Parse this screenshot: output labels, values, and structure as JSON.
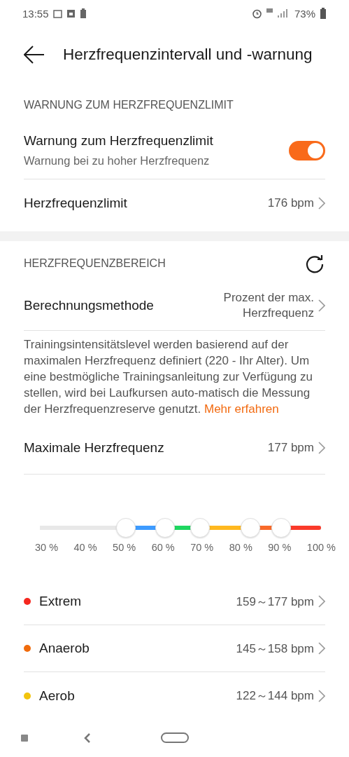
{
  "status_bar": {
    "time": "13:55",
    "battery": "73%"
  },
  "header": {
    "title": "Herzfrequenzintervall und -warnung"
  },
  "limit_section": {
    "title": "WARNUNG ZUM HERZFREQUENZLIMIT",
    "warning": {
      "label": "Warnung zum Herzfrequenzlimit",
      "sublabel": "Warnung bei zu hoher Herzfrequenz",
      "on": true
    },
    "limit": {
      "label": "Herzfrequenzlimit",
      "value": "176 bpm"
    }
  },
  "range_section": {
    "title": "HERZFREQUENZBEREICH",
    "method": {
      "label": "Berechnungsmethode",
      "value": "Prozent der max. Herzfrequenz"
    },
    "description": "Trainingsintensitätslevel werden basierend auf der maximalen Herzfrequenz definiert (220 - Ihr Alter). Um eine bestmögliche Trainingsanleitung zur Verfügung zu stellen, wird bei Laufkursen auto-matisch die Messung der Herzfrequenzreserve genutzt.",
    "link": "Mehr erfahren",
    "max": {
      "label": "Maximale Herzfrequenz",
      "value": "177 bpm"
    },
    "slider": {
      "thumbs": [
        {
          "level": 0.307,
          "color": "#3d9bff"
        },
        {
          "level": 0.446,
          "color": "#1ed760"
        },
        {
          "level": 0.569,
          "color": "#ffb81f"
        },
        {
          "level": 0.748,
          "color": "#f96a2a"
        },
        {
          "level": 0.858,
          "color": "#fa3a2a"
        }
      ],
      "labels": [
        "30 %",
        "40 %",
        "50 %",
        "60 %",
        "70 %",
        "80 %",
        "90 %",
        "100 %"
      ]
    },
    "zones": [
      {
        "name": "Extrem",
        "range": "159～177 bpm",
        "color": "#f5271f"
      },
      {
        "name": "Anaerob",
        "range": "145～158 bpm",
        "color": "#f06b0c"
      },
      {
        "name": "Aerob",
        "range": "122～144 bpm",
        "color": "#f2c40d"
      }
    ]
  }
}
